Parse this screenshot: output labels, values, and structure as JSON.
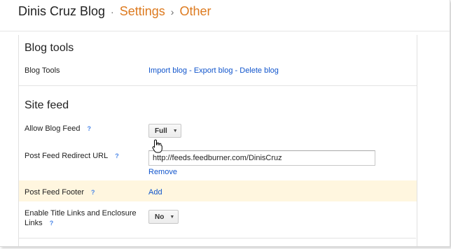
{
  "breadcrumb": {
    "blog": "Dinis Cruz Blog",
    "sep1": "·",
    "settings": "Settings",
    "sep2": "›",
    "other": "Other"
  },
  "blog_tools": {
    "title": "Blog tools",
    "label": "Blog Tools",
    "import": "Import blog",
    "dash1": " - ",
    "export": "Export blog",
    "dash2": " - ",
    "delete": "Delete blog"
  },
  "site_feed": {
    "title": "Site feed",
    "allow_label": "Allow Blog Feed",
    "allow_value": "Full",
    "redirect_label": "Post Feed Redirect URL",
    "redirect_value": "http://feeds.feedburner.com/DinisCruz",
    "remove": "Remove",
    "footer_label": "Post Feed Footer",
    "footer_add": "Add",
    "enclosure_label_line1": "Enable Title Links and Enclosure",
    "enclosure_label_line2": "Links",
    "enclosure_value": "No",
    "help": "?"
  },
  "colors": {
    "accent": "#dd7a1f",
    "link": "#1155cc",
    "highlight": "#fff6df"
  }
}
